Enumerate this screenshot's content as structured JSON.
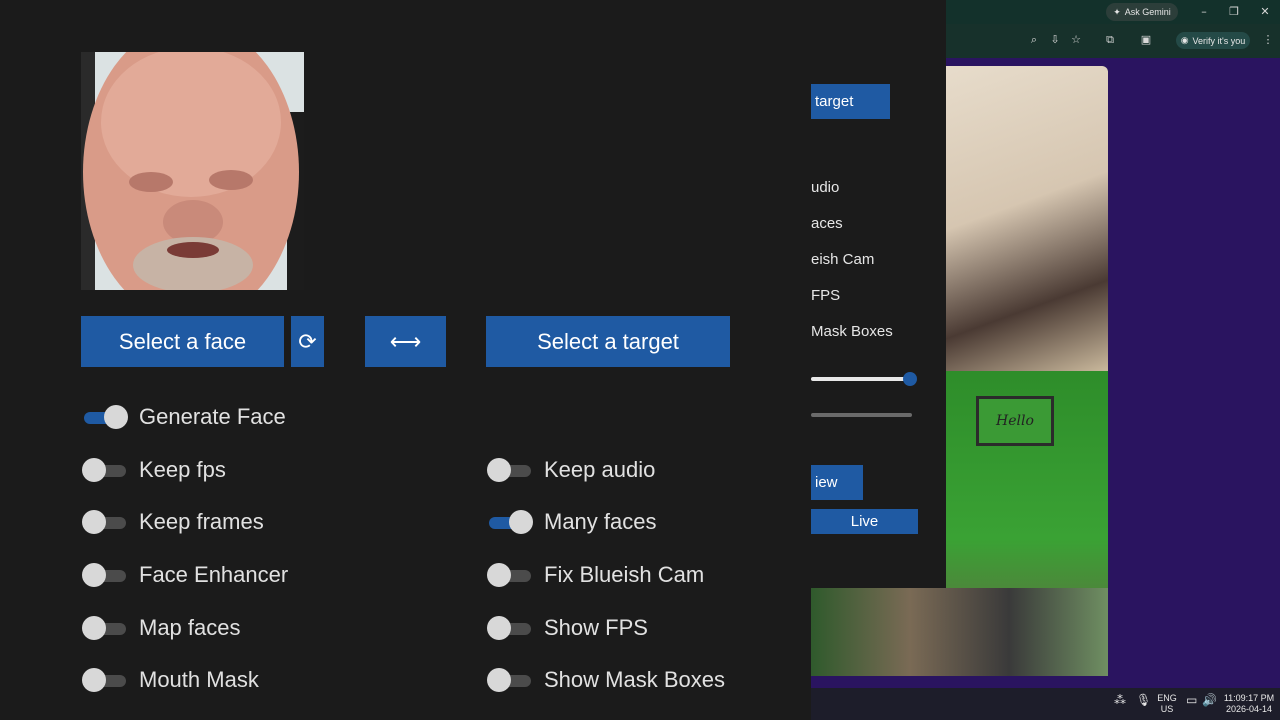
{
  "browser": {
    "ask_gemini": "Ask Gemini",
    "verify": "Verify it's you",
    "window_controls": [
      "minimize-icon",
      "restore-icon",
      "close-icon"
    ],
    "video_sign_text": "Hello"
  },
  "taskbar": {
    "lang_top": "ENG",
    "lang_bottom": "US",
    "time": "11:09:17 PM",
    "date": "2026-04-14"
  },
  "app2": {
    "select_target_label": "target",
    "rows": [
      "udio",
      "aces",
      "eish Cam",
      "FPS",
      "Mask Boxes"
    ],
    "preview_label": "iew",
    "live_label": "Live",
    "slider_value": 1.0
  },
  "app": {
    "buttons": {
      "select_face": "Select a face",
      "refresh_icon": "⟳",
      "swap_icon": "⟷",
      "select_target": "Select a target"
    },
    "toggles": {
      "generate_face": {
        "label": "Generate Face",
        "on": true
      },
      "keep_fps": {
        "label": "Keep fps",
        "on": false
      },
      "keep_frames": {
        "label": "Keep frames",
        "on": false
      },
      "face_enhancer": {
        "label": "Face Enhancer",
        "on": false
      },
      "map_faces": {
        "label": "Map faces",
        "on": false
      },
      "mouth_mask": {
        "label": "Mouth Mask",
        "on": false
      },
      "keep_audio": {
        "label": "Keep audio",
        "on": false
      },
      "many_faces": {
        "label": "Many faces",
        "on": true
      },
      "fix_blueish_cam": {
        "label": "Fix Blueish Cam",
        "on": false
      },
      "show_fps": {
        "label": "Show FPS",
        "on": false
      },
      "show_mask_boxes": {
        "label": "Show Mask Boxes",
        "on": false
      }
    }
  },
  "colors": {
    "accent": "#1f5aa3",
    "app_bg": "#1b1b1b",
    "text": "#e1e1e1"
  }
}
